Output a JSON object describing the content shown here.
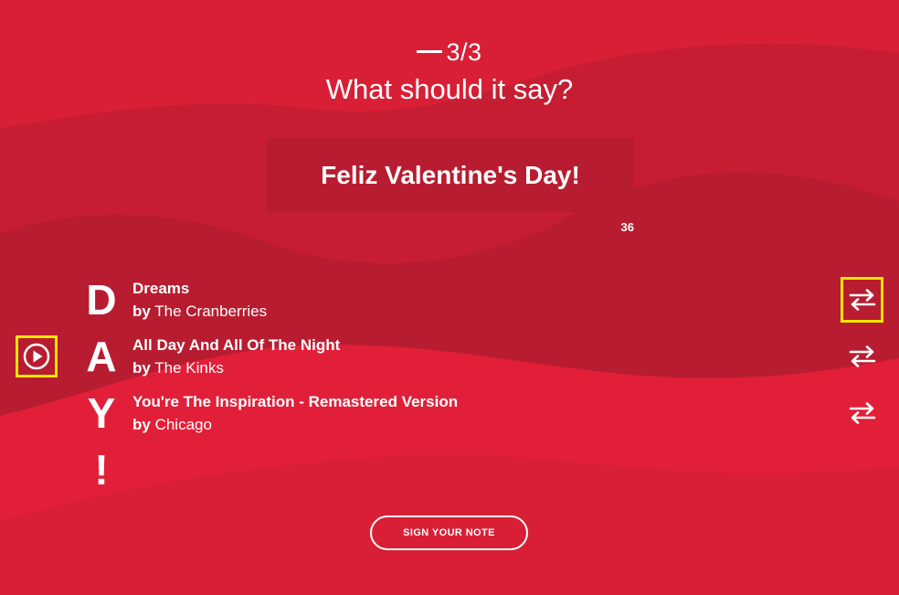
{
  "step": {
    "label": "3/3"
  },
  "prompt": "What should it say?",
  "note": {
    "text": "Feliz Valentine's Day!",
    "char_count": "36"
  },
  "letters": [
    "D",
    "A",
    "Y",
    "!"
  ],
  "tracks": [
    {
      "title": "Dreams",
      "by": "by",
      "artist": "The Cranberries"
    },
    {
      "title": "All Day And All Of The Night",
      "by": "by",
      "artist": "The Kinks"
    },
    {
      "title": "You're The Inspiration - Remastered Version",
      "by": "by",
      "artist": "Chicago"
    }
  ],
  "buttons": {
    "sign": "SIGN YOUR NOTE"
  },
  "icons": {
    "play": "play-icon",
    "swap": "swap-icon"
  },
  "colors": {
    "background": "#d81f36",
    "wave_dark": "#b81c30",
    "note_box": "#b81c30",
    "highlight": "#f2e600",
    "text": "#ffffff"
  }
}
